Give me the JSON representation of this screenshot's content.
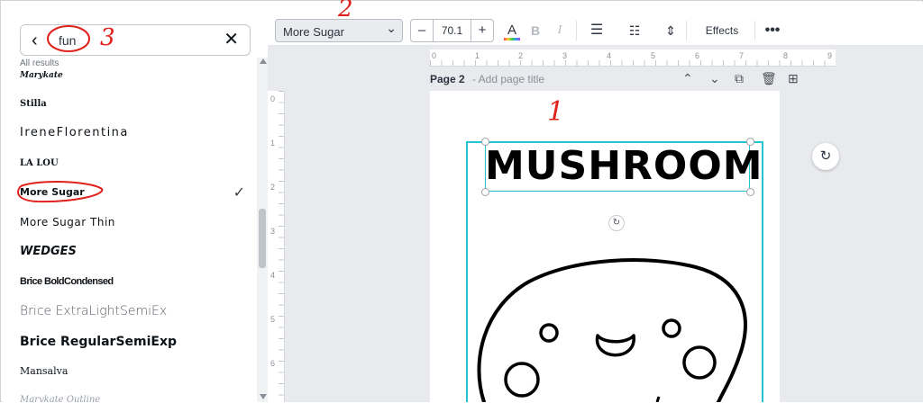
{
  "search": {
    "query": "fun",
    "back_icon": "chevron-left-icon",
    "clear_icon": "close-icon"
  },
  "results_label": "All results",
  "fonts": [
    {
      "name": "Marykate"
    },
    {
      "name": "Stilla"
    },
    {
      "name": "IreneFlorentina"
    },
    {
      "name": "LA LOU"
    },
    {
      "name": "More Sugar",
      "selected": true
    },
    {
      "name": "More Sugar Thin"
    },
    {
      "name": "WEDGES"
    },
    {
      "name": "Brice BoldCondensed"
    },
    {
      "name": "Brice ExtraLightSemiEx"
    },
    {
      "name": "Brice RegularSemiExp"
    },
    {
      "name": "Mansalva"
    },
    {
      "name": "Marykate Outline"
    }
  ],
  "toolbar": {
    "font": "More Sugar",
    "size": "70.1",
    "minus": "–",
    "plus": "+",
    "text_color_glyph": "A",
    "bold": "B",
    "italic": "I",
    "effects": "Effects"
  },
  "ruler": {
    "top_ticks": [
      "0",
      "1",
      "2",
      "3",
      "4",
      "5",
      "6",
      "7",
      "8",
      "9"
    ],
    "left_ticks": [
      "0",
      "1",
      "2",
      "3",
      "4",
      "5",
      "6"
    ]
  },
  "page": {
    "title": "Page 2",
    "add_title": "- Add page title"
  },
  "canvas_text": "MUSHROOM",
  "annotations": {
    "one": "1",
    "two": "2",
    "three": "3"
  },
  "colors": {
    "selection": "#23c3d1",
    "annotation": "#e0201a"
  }
}
